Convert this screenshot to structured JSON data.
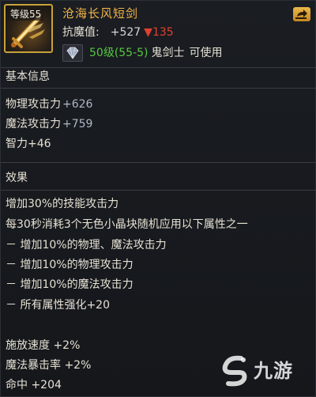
{
  "item": {
    "level_tag": "等级55",
    "name": "沧海长风短剑",
    "resist_label": "抗魔值:",
    "resist_gain": "+527",
    "resist_loss": "▼135",
    "requirement_level": "50级(55-5)",
    "requirement_class": "鬼剑士",
    "requirement_usable": "可使用",
    "icon": "short-sword-icon",
    "gem_icon": "diamond-icon"
  },
  "basic": {
    "title": "基本信息",
    "stats": [
      {
        "label": "物理攻击力",
        "value": "+626"
      },
      {
        "label": "魔法攻击力",
        "value": "+759"
      },
      {
        "label": "智力",
        "value": "+46"
      }
    ]
  },
  "effects": {
    "title": "效果",
    "lines": [
      "增加30%的技能攻击力",
      "每30秒消耗3个无色小晶块随机应用以下属性之一",
      "－ 增加10%的物理、魔法攻击力",
      "－ 增加10%的物理攻击力",
      "－ 增加10%的魔法攻击力",
      "－ 所有属性强化+20"
    ]
  },
  "extra_stats": [
    "施放速度 +2%",
    "魔法暴击率 +2%",
    "命中 +204"
  ],
  "watermark": {
    "text": "九游",
    "icon": "jiuyou-logo-icon"
  },
  "colors": {
    "item_name": "#f2b54a",
    "requirement_level": "#57c840",
    "resist_loss": "#e2402f",
    "stat_value": "#aeb8c6",
    "icon_border": "#c7a23a"
  }
}
